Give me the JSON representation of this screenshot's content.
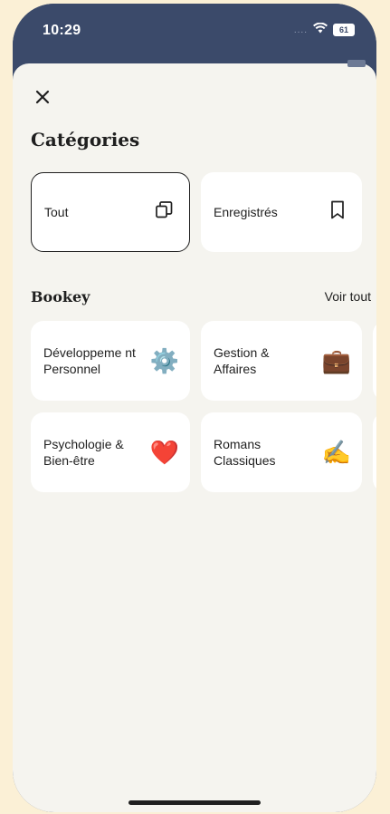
{
  "status_bar": {
    "time": "10:29",
    "signal": "....",
    "battery": "61",
    "wifi_icon": "wifi-icon"
  },
  "header": {
    "close_icon": "close-icon",
    "title": "Catégories"
  },
  "filters": [
    {
      "label": "Tout",
      "icon": "copy-icon",
      "selected": true
    },
    {
      "label": "Enregistrés",
      "icon": "bookmark-icon",
      "selected": false
    }
  ],
  "section": {
    "title": "Bookey",
    "see_all": "Voir tout"
  },
  "categories": [
    {
      "label": "Développeme nt Personnel",
      "emoji": "⚙️",
      "icon": "gear-icon"
    },
    {
      "label": "Gestion & Affaires",
      "emoji": "💼",
      "icon": "briefcase-icon"
    },
    {
      "label": "Psychologie & Bien-être",
      "emoji": "❤️",
      "icon": "heart-icon"
    },
    {
      "label": "Romans Classiques",
      "emoji": "✍️",
      "icon": "writing-hand-icon"
    }
  ],
  "colors": {
    "background": "#fbf0d6",
    "status_bar": "#3b4a6a",
    "sheet": "#f5f4ef",
    "card": "#ffffff",
    "text": "#1f1f1f"
  }
}
